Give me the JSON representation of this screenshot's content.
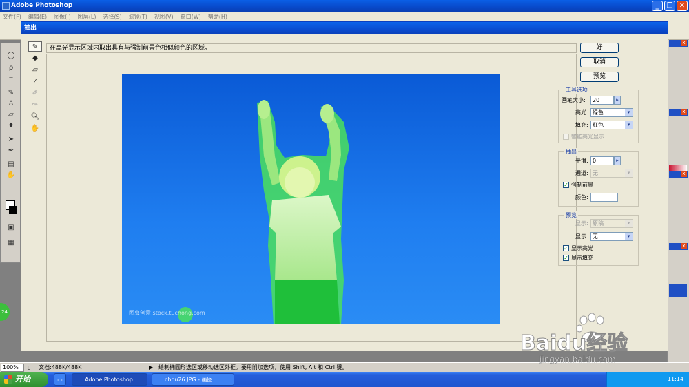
{
  "app": {
    "title": "Adobe Photoshop",
    "menu": [
      "文件(F)",
      "编辑(E)",
      "图像(I)",
      "图层(L)",
      "选择(S)",
      "滤镜(T)",
      "视图(V)",
      "窗口(W)",
      "帮助(H)"
    ],
    "window_buttons": [
      "_",
      "❐",
      "✕"
    ]
  },
  "dialog": {
    "title": "抽出",
    "hint": "在高光显示区域内取出具有与强制前景色相似颜色的区域。",
    "buttons": {
      "ok": "好",
      "cancel": "取消",
      "preview": "预览"
    },
    "tool_options": {
      "label": "工具选项",
      "brush_size_label": "画笔大小:",
      "brush_size_value": "20",
      "highlight_label": "高光:",
      "highlight_value": "绿色",
      "fill_label": "填充:",
      "fill_value": "红色",
      "smart_highlight_label": "智能高光显示",
      "smart_highlight_checked": false
    },
    "extraction": {
      "label": "抽出",
      "smooth_label": "平滑:",
      "smooth_value": "0",
      "channel_label": "通道:",
      "channel_value": "无",
      "force_fg_label": "强制前景",
      "force_fg_checked": true,
      "color_label": "颜色:",
      "color_value": "#ffffff"
    },
    "preview": {
      "label": "预览",
      "show_label": "显示:",
      "show_value": "原稿",
      "display_label": "显示:",
      "display_value": "无",
      "show_highlight_label": "显示高光",
      "show_highlight_checked": true,
      "show_fill_label": "显示填充",
      "show_fill_checked": true
    },
    "photo_watermark": "图虫创意 stock.tuchong.com",
    "highlight_color": "#49e05a"
  },
  "statusbar": {
    "zoom": "100%",
    "doc_size": "文档:488K/488K",
    "hint": "绘制椭圆形选区或移动选区外框。要用附加选项，使用 Shift, Alt 和 Ctrl 键。"
  },
  "taskbar": {
    "start_label": "开始",
    "tasks": [
      "Adobe Photoshop",
      "chou26.JPG - 画图"
    ],
    "clock": "11:14"
  },
  "desktop_badge": "24",
  "watermark": {
    "brand": "Baidu经验",
    "url": "jingyan.baidu.com"
  }
}
